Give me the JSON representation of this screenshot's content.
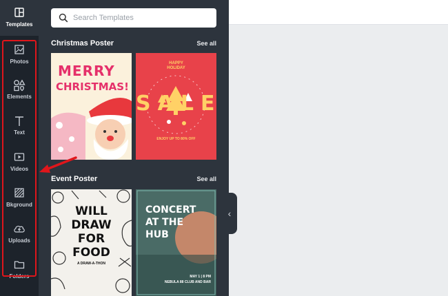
{
  "rail": {
    "items": [
      {
        "label": "Templates",
        "icon": "templates-icon"
      },
      {
        "label": "Photos",
        "icon": "photos-icon"
      },
      {
        "label": "Elements",
        "icon": "elements-icon"
      },
      {
        "label": "Text",
        "icon": "text-icon"
      },
      {
        "label": "Videos",
        "icon": "videos-icon"
      },
      {
        "label": "Bkground",
        "icon": "background-icon"
      },
      {
        "label": "Uploads",
        "icon": "uploads-icon"
      },
      {
        "label": "Folders",
        "icon": "folders-icon"
      }
    ]
  },
  "search": {
    "placeholder": "Search Templates"
  },
  "sections": [
    {
      "title": "Christmas Poster",
      "see_all": "See all",
      "templates": [
        {
          "lines": [
            "MERRY",
            "CHRISTMAS!"
          ]
        },
        {
          "top": [
            "HAPPY",
            "HOLIDAY"
          ],
          "word": "SALE",
          "bottom": "ENJOY UP TO 80% OFF"
        }
      ]
    },
    {
      "title": "Event Poster",
      "see_all": "See all",
      "templates": [
        {
          "lines": [
            "WILL",
            "DRAW",
            "FOR",
            "FOOD"
          ],
          "sub": "A DRAW-A-THON"
        },
        {
          "lines": [
            "CONCERT",
            "AT THE",
            "HUB"
          ],
          "date": "MAY 1 | 8 PM",
          "venue": "NEBULA 88 CLUB AND BAR"
        }
      ]
    }
  ],
  "colors": {
    "rail": "#1d232b",
    "panel": "#2d343d",
    "highlight": "#e0161b",
    "canvas": "#ebedef"
  }
}
